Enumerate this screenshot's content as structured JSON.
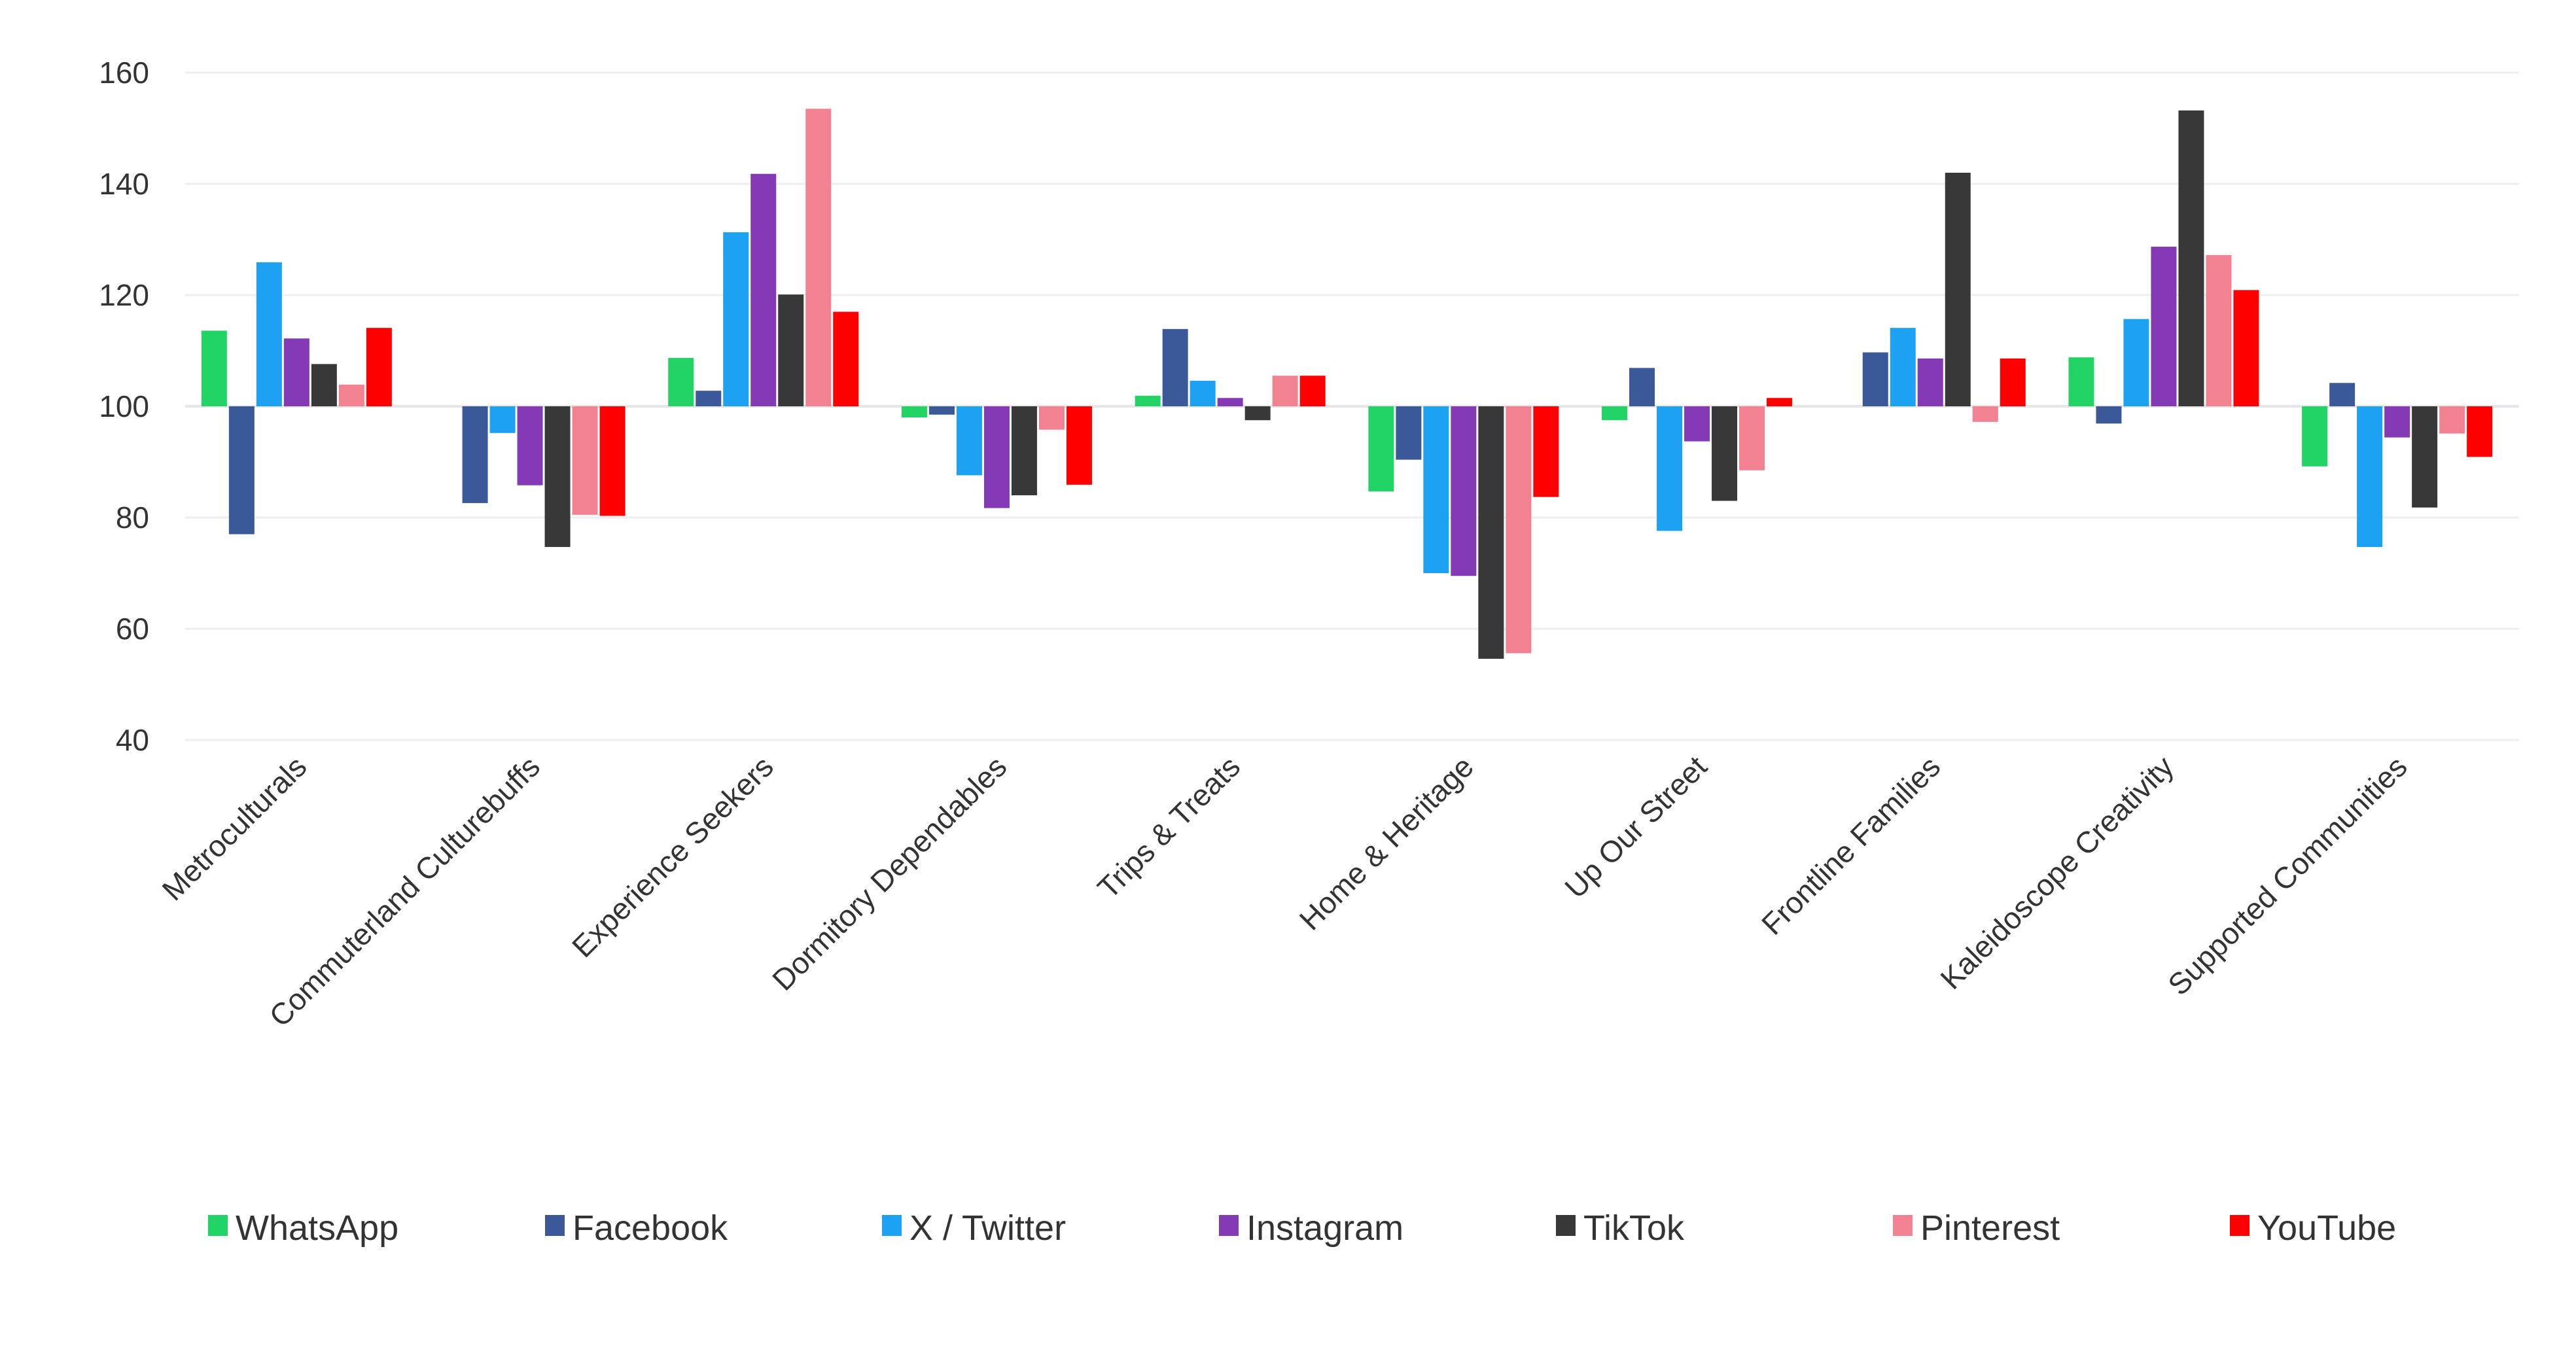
{
  "chart_data": {
    "type": "bar",
    "title": "",
    "xlabel": "",
    "ylabel": "",
    "ylim": [
      40,
      160
    ],
    "yticks": [
      40,
      60,
      80,
      100,
      120,
      140,
      160
    ],
    "baseline": 100,
    "grid": true,
    "legend_position": "bottom",
    "categories": [
      "Metroculturals",
      "Commuterland Culturebuffs",
      "Experience Seekers",
      "Dormitory Dependables",
      "Trips & Treats",
      "Home & Heritage",
      "Up Our Street",
      "Frontline Families",
      "Kaleidoscope Creativity",
      "Supported Communities"
    ],
    "series": [
      {
        "name": "WhatsApp",
        "color": "#22d466",
        "values": [
          113.6,
          100.0,
          108.7,
          98.0,
          101.9,
          84.7,
          97.5,
          100.0,
          108.8,
          89.2
        ]
      },
      {
        "name": "Facebook",
        "color": "#3b5998",
        "values": [
          77.0,
          82.6,
          102.8,
          98.5,
          113.9,
          90.4,
          106.9,
          109.7,
          96.9,
          104.2
        ]
      },
      {
        "name": "X / Twitter",
        "color": "#1da1f2",
        "values": [
          125.9,
          95.2,
          131.3,
          87.6,
          104.6,
          70.0,
          77.6,
          114.1,
          115.7,
          74.7
        ]
      },
      {
        "name": "Instagram",
        "color": "#833ab4",
        "values": [
          112.2,
          85.8,
          141.8,
          81.7,
          101.5,
          69.5,
          93.7,
          108.6,
          128.7,
          94.4
        ]
      },
      {
        "name": "TikTok",
        "color": "#383838",
        "values": [
          107.6,
          74.7,
          120.1,
          84.0,
          97.5,
          54.6,
          83.0,
          142.0,
          153.2,
          81.8
        ]
      },
      {
        "name": "Pinterest",
        "color": "#f28291",
        "values": [
          103.9,
          80.5,
          153.5,
          95.8,
          105.5,
          55.6,
          88.5,
          97.2,
          127.2,
          95.1
        ]
      },
      {
        "name": "YouTube",
        "color": "#ff0000",
        "values": [
          114.1,
          80.3,
          117.0,
          85.9,
          105.5,
          83.7,
          101.5,
          108.6,
          120.9,
          90.9
        ]
      }
    ]
  }
}
